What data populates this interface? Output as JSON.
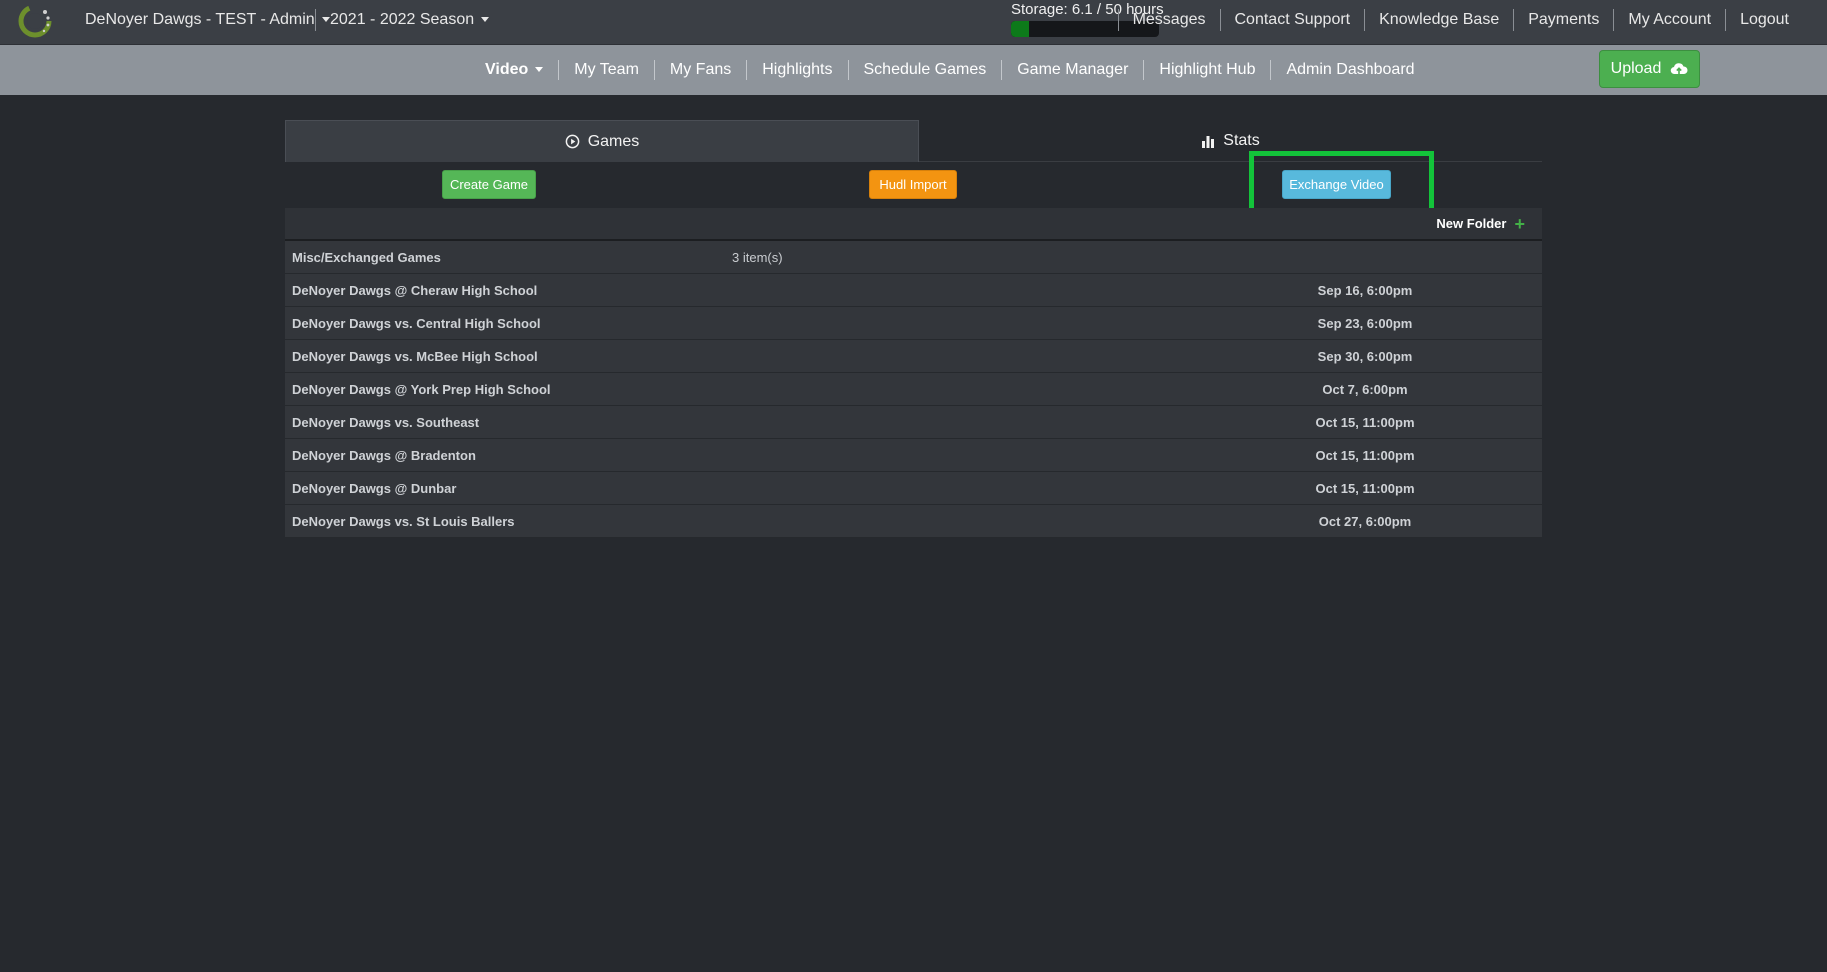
{
  "topbar": {
    "team": "DeNoyer Dawgs - TEST - Admin",
    "season": "2021 - 2022 Season",
    "storage_label": "Storage: 6.1 / 50 hours",
    "storage_fraction": 0.122,
    "links": [
      "Messages",
      "Contact Support",
      "Knowledge Base",
      "Payments",
      "My Account",
      "Logout"
    ]
  },
  "nav": {
    "links": [
      "Video",
      "My Team",
      "My Fans",
      "Highlights",
      "Schedule Games",
      "Game Manager",
      "Highlight Hub",
      "Admin Dashboard"
    ],
    "upload_label": "Upload"
  },
  "tabs": {
    "games": "Games",
    "stats": "Stats"
  },
  "actions": {
    "create_game": "Create Game",
    "hudl_import": "Hudl Import",
    "exchange_video": "Exchange Video"
  },
  "table": {
    "new_folder": "New Folder",
    "folder": {
      "name": "Misc/Exchanged Games",
      "count": "3 item(s)"
    },
    "games": [
      {
        "name": "DeNoyer Dawgs @ Cheraw High School",
        "date": "Sep 16, 6:00pm"
      },
      {
        "name": "DeNoyer Dawgs vs. Central High School",
        "date": "Sep 23, 6:00pm"
      },
      {
        "name": "DeNoyer Dawgs vs. McBee High School",
        "date": "Sep 30, 6:00pm"
      },
      {
        "name": "DeNoyer Dawgs @ York Prep High School",
        "date": "Oct 7, 6:00pm"
      },
      {
        "name": "DeNoyer Dawgs vs. Southeast",
        "date": "Oct 15, 11:00pm"
      },
      {
        "name": "DeNoyer Dawgs @ Bradenton",
        "date": "Oct 15, 11:00pm"
      },
      {
        "name": "DeNoyer Dawgs @ Dunbar",
        "date": "Oct 15, 11:00pm"
      },
      {
        "name": "DeNoyer Dawgs vs. St Louis Ballers",
        "date": "Oct 27, 6:00pm"
      }
    ]
  },
  "colors": {
    "highlight": "#13c33a",
    "create": "#55b757",
    "hudl": "#f39411",
    "exchange": "#58b9dc"
  }
}
